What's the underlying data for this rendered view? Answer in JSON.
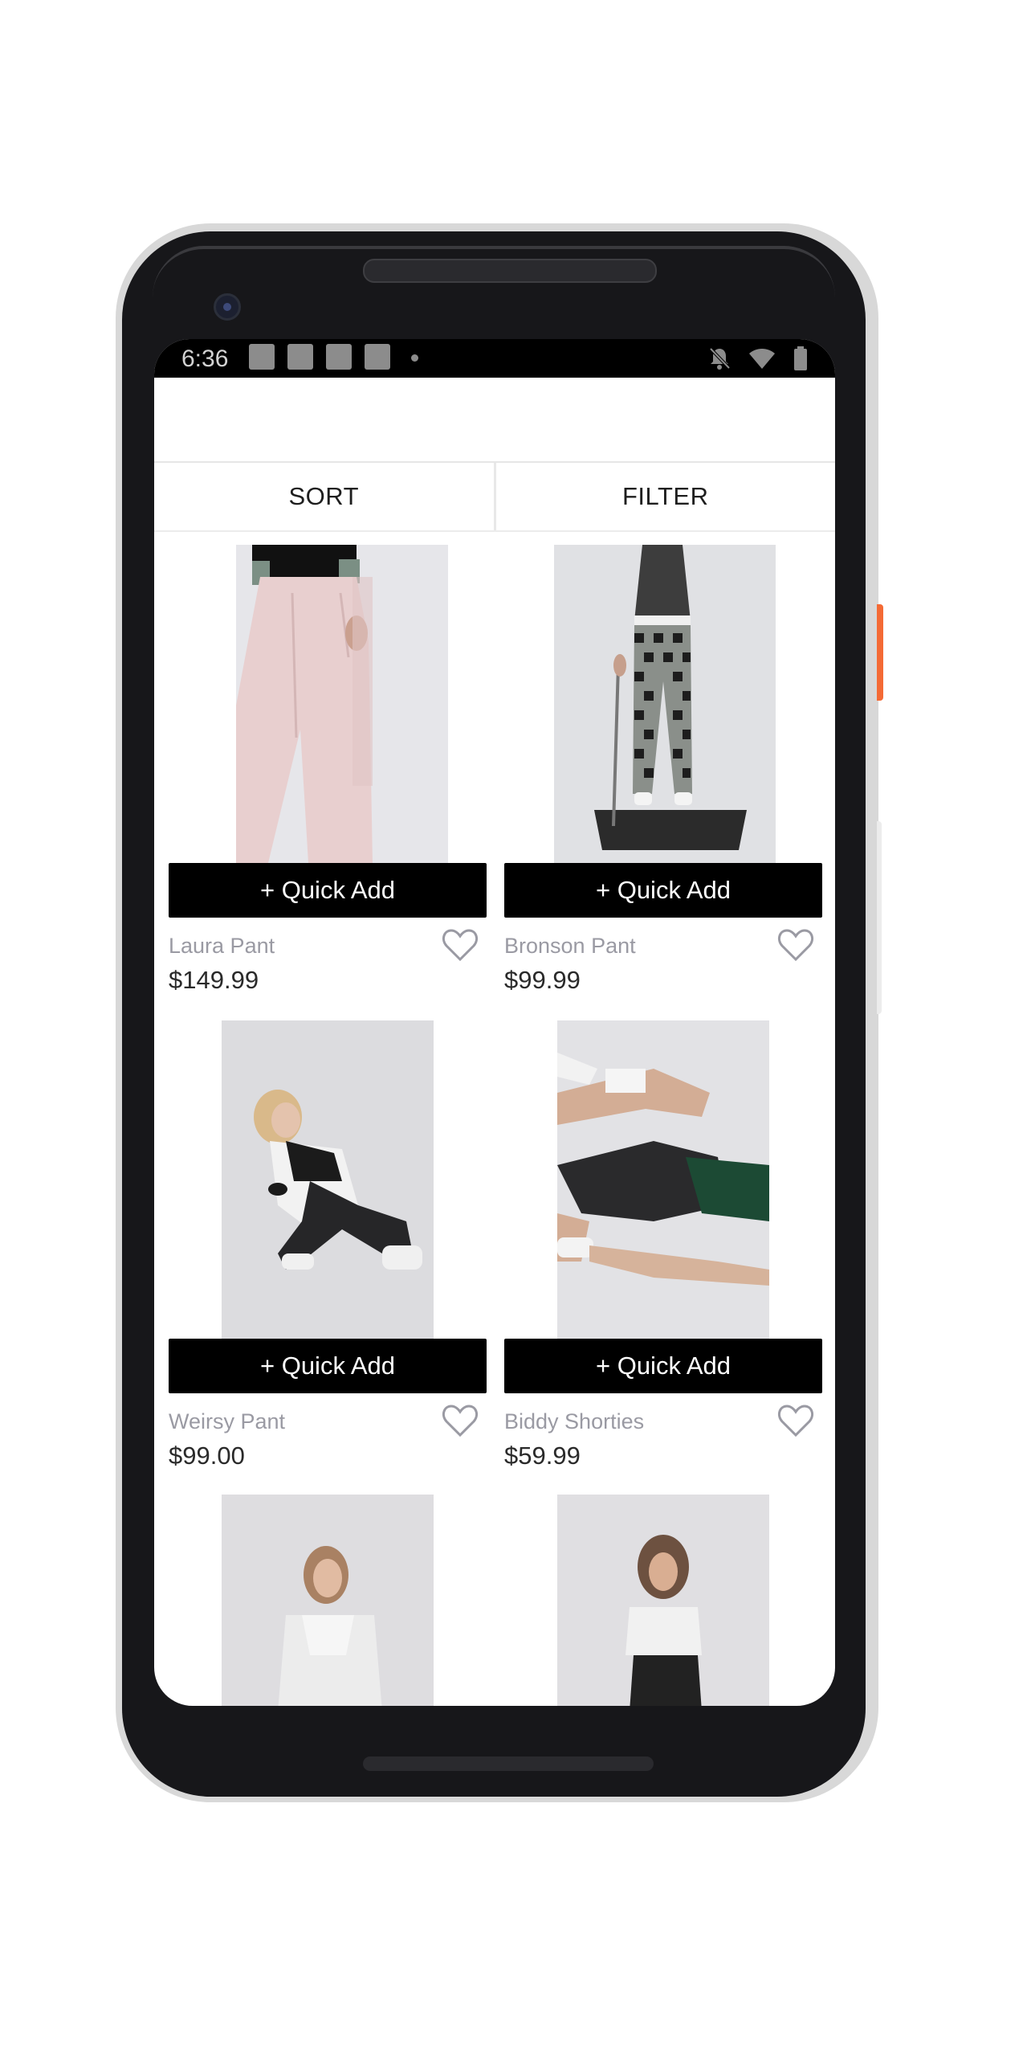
{
  "status_bar": {
    "time": "6:36",
    "notification_icons": [
      "notification-square-icon",
      "notification-square-icon",
      "notification-square-icon",
      "notification-square-icon",
      "more-dot-icon"
    ],
    "right_icons": [
      "bell-off-icon",
      "wifi-icon",
      "battery-icon"
    ]
  },
  "toolbar": {
    "sort_label": "SORT",
    "filter_label": "FILTER"
  },
  "products": [
    {
      "name": "Laura Pant",
      "price": "$149.99",
      "quick_add": "+ Quick Add",
      "favorite_icon": "heart-outline-icon"
    },
    {
      "name": "Bronson Pant",
      "price": "$99.99",
      "quick_add": "+ Quick Add",
      "favorite_icon": "heart-outline-icon"
    },
    {
      "name": "Weirsy Pant",
      "price": "$99.00",
      "quick_add": "+ Quick Add",
      "favorite_icon": "heart-outline-icon"
    },
    {
      "name": "Biddy Shorties",
      "price": "$59.99",
      "quick_add": "+ Quick Add",
      "favorite_icon": "heart-outline-icon"
    }
  ],
  "colors": {
    "accent_button": "#000000",
    "product_name": "#9a9aa3",
    "price": "#2a2a2a",
    "phone_body": "#17171a",
    "side_button": "#f46a35"
  }
}
